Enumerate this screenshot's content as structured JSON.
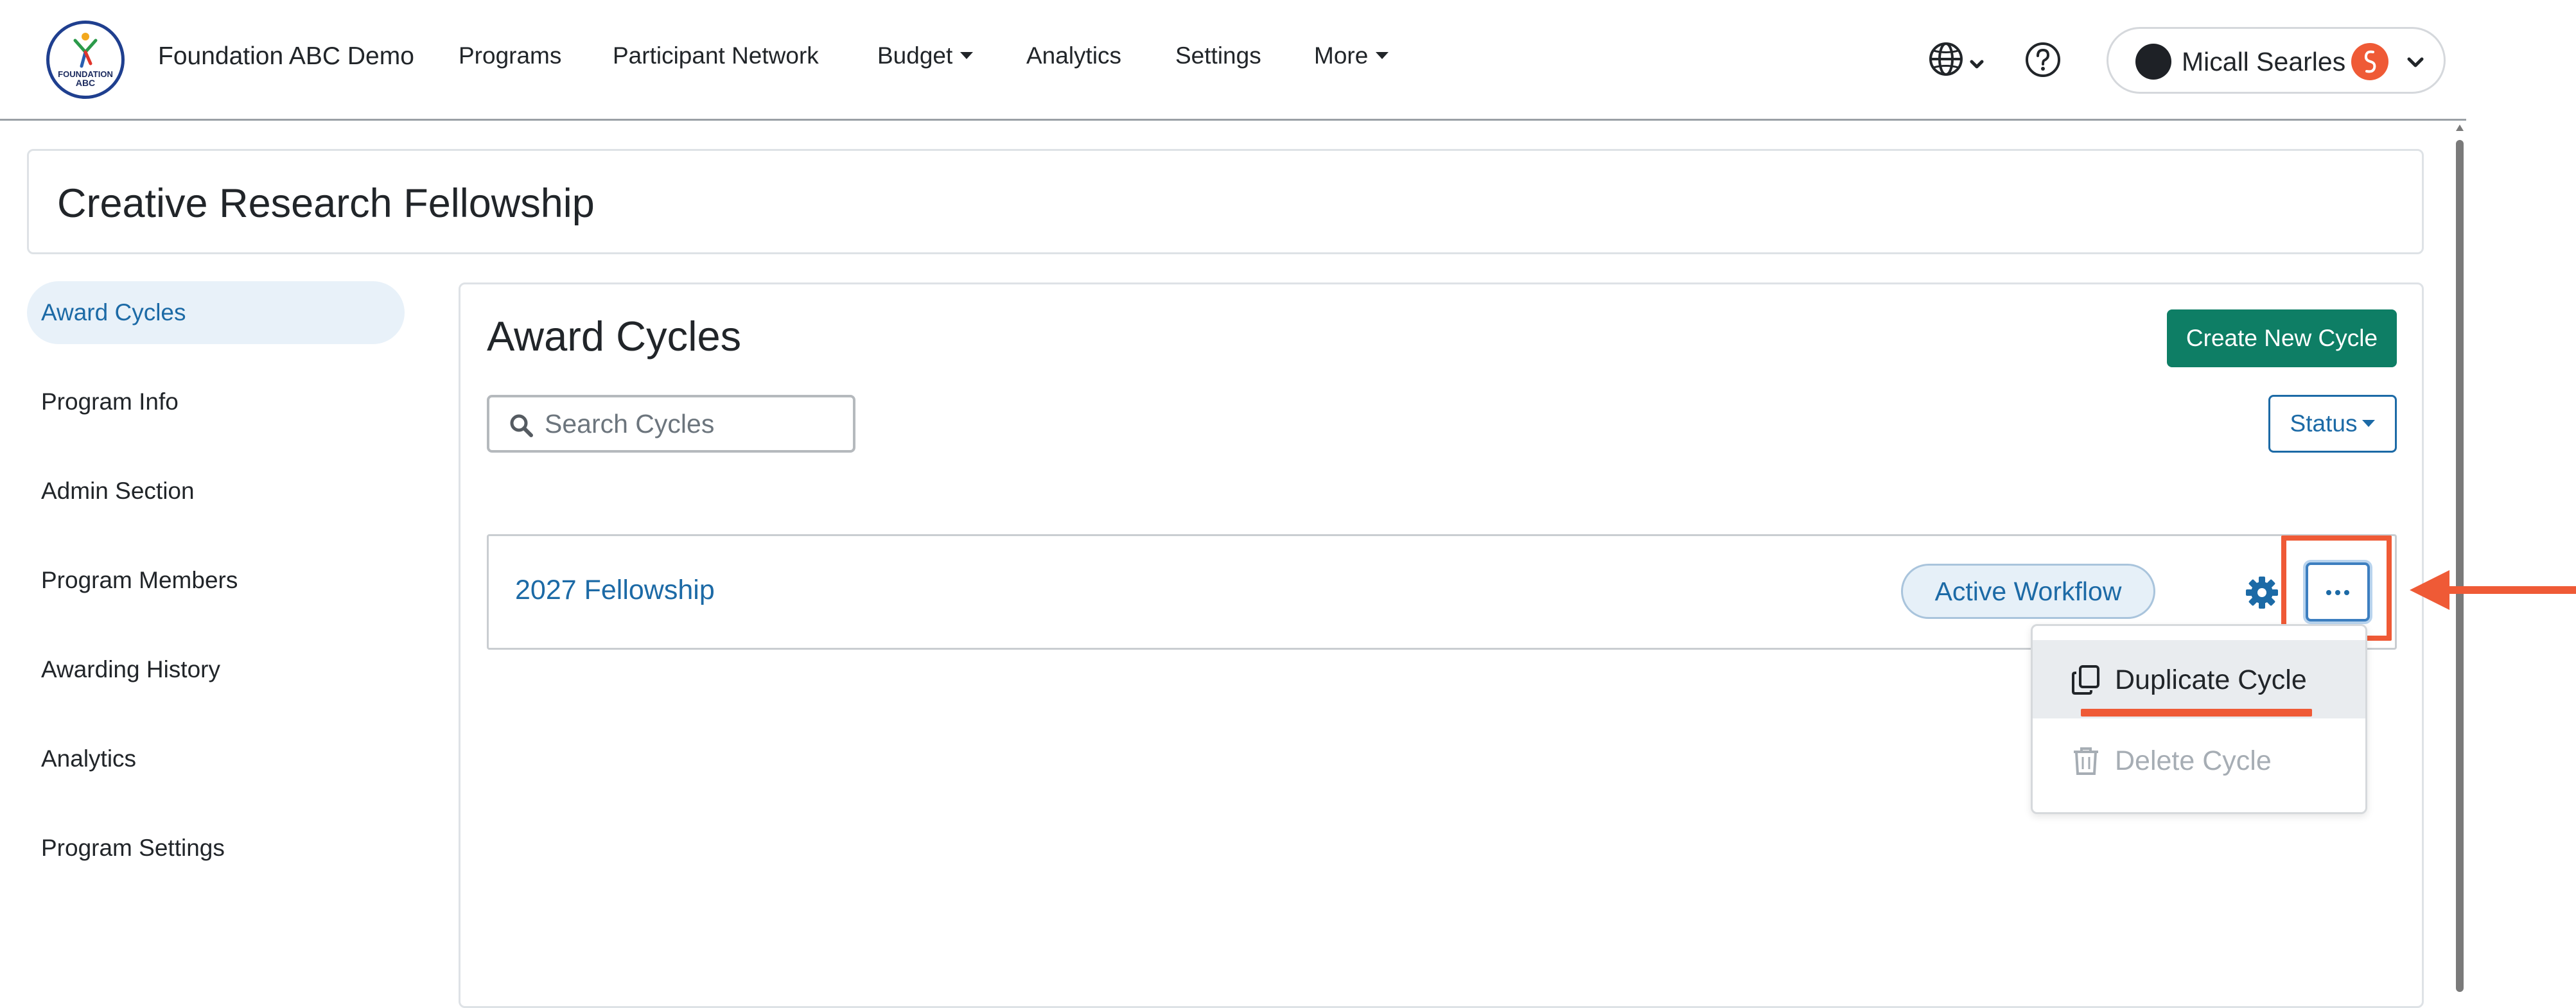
{
  "navbar": {
    "logo": {
      "line1": "FOUNDATION",
      "line2": "ABC"
    },
    "brand": "Foundation ABC Demo",
    "items": [
      {
        "label": "Programs",
        "dropdown": false
      },
      {
        "label": "Participant Network",
        "dropdown": false
      },
      {
        "label": "Budget",
        "dropdown": true
      },
      {
        "label": "Analytics",
        "dropdown": false
      },
      {
        "label": "Settings",
        "dropdown": false
      },
      {
        "label": "More",
        "dropdown": true
      }
    ],
    "user": {
      "name": "Micall Searles",
      "badge_color": "#ef5a36"
    }
  },
  "page": {
    "title": "Creative Research Fellowship"
  },
  "sidebar": {
    "items": [
      {
        "label": "Award Cycles",
        "active": true
      },
      {
        "label": "Program Info",
        "active": false
      },
      {
        "label": "Admin Section",
        "active": false
      },
      {
        "label": "Program Members",
        "active": false
      },
      {
        "label": "Awarding History",
        "active": false
      },
      {
        "label": "Analytics",
        "active": false
      },
      {
        "label": "Program Settings",
        "active": false
      }
    ]
  },
  "main": {
    "title": "Award Cycles",
    "create_button": "Create New Cycle",
    "search": {
      "placeholder": "Search Cycles",
      "value": ""
    },
    "status_filter": "Status",
    "cycles": [
      {
        "name": "2027 Fellowship",
        "status": "Active Workflow"
      }
    ],
    "menu": {
      "items": [
        {
          "label": "Duplicate Cycle",
          "icon": "copy-icon",
          "disabled": false
        },
        {
          "label": "Delete Cycle",
          "icon": "trash-icon",
          "disabled": true
        }
      ]
    }
  },
  "colors": {
    "primary": "#0e7e65",
    "link": "#1c6aa6",
    "annotation": "#ef5a36"
  }
}
